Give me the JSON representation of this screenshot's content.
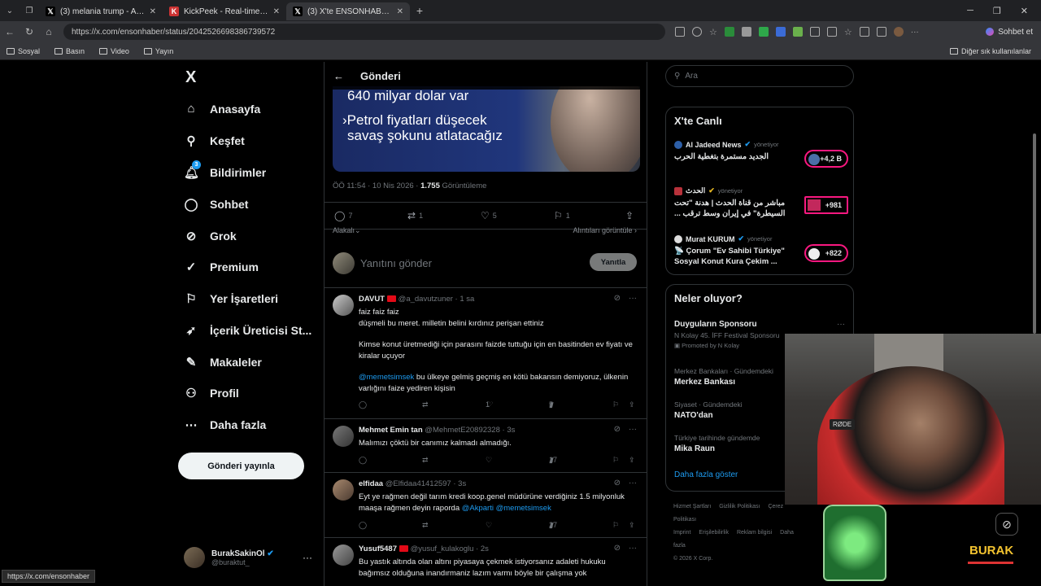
{
  "browser": {
    "tabs": [
      {
        "title": "(3) melania trump - Arama / X",
        "icon": "x-icon",
        "active": false
      },
      {
        "title": "KickPeek - Real-time URL Crawler",
        "icon": "kickpeek-icon",
        "active": false
      },
      {
        "title": "(3) X'te ENSONHABER: \"Mehmet Ş",
        "icon": "x-icon",
        "active": true
      }
    ],
    "new_tab": "+",
    "url": "https://x.com/ensonhaber/status/2042526698386739572",
    "copilot_label": "Sohbet et",
    "bookmarks": [
      "Sosyal",
      "Basın",
      "Video",
      "Yayın"
    ],
    "other_bookmarks": "Diğer sık kullanılanlar",
    "status_url": "https://x.com/ensonhaber"
  },
  "nav": {
    "logo": "X",
    "items": [
      {
        "label": "Anasayfa",
        "icon": "home-icon"
      },
      {
        "label": "Keşfet",
        "icon": "search-icon"
      },
      {
        "label": "Bildirimler",
        "icon": "bell-icon",
        "badge": "3"
      },
      {
        "label": "Sohbet",
        "icon": "chat-icon"
      },
      {
        "label": "Grok",
        "icon": "grok-icon"
      },
      {
        "label": "Premium",
        "icon": "premium-icon"
      },
      {
        "label": "Yer İşaretleri",
        "icon": "bookmark-icon"
      },
      {
        "label": "İçerik Üreticisi St...",
        "icon": "rocket-icon"
      },
      {
        "label": "Makaleler",
        "icon": "articles-icon"
      },
      {
        "label": "Profil",
        "icon": "person-icon"
      },
      {
        "label": "Daha fazla",
        "icon": "more-circle-icon"
      }
    ],
    "post_button": "Gönderi yayınla",
    "account": {
      "name": "BurakSakinOl",
      "handle": "@buraktut_",
      "more": "···"
    }
  },
  "post": {
    "header_title": "Gönderi",
    "media_line1": "640 milyar dolar var",
    "media_line2": "Petrol fiyatları düşecek",
    "media_line3": "savaş şokunu atlatacağız",
    "time": "ÖÖ 11:54 · 10 Nis 2026 · ",
    "views": "1.755",
    "views_label": " Görüntüleme",
    "stats": {
      "replies": "7",
      "reposts": "1",
      "likes": "5",
      "bookmarks": "1"
    },
    "sort_label": "Alakalı",
    "quotes_label": "Alıntıları görüntüle",
    "reply_placeholder": "Yanıtını gönder",
    "reply_button": "Yanıtla"
  },
  "replies": [
    {
      "name": "DAVUT",
      "handle": "@a_davutzuner",
      "time": "· 1 sa",
      "p1": "faiz faiz faiz",
      "p1b": "düşmeli bu meret. milletin belini kırdınız perişan ettiniz",
      "p2": "Kimse konut üretmediği için parasını faizde tuttuğu için en basitinden ev fiyatı ve kiralar uçuyor",
      "mention": "@memetsimsek",
      "p3": " bu ülkeye gelmiş geçmiş en kötü bakansın demiyoruz, ülkenin varlığını faize yediren kişisin",
      "likes": "1",
      "views": "5"
    },
    {
      "name": "Mehmet Emin tan",
      "handle": "@MehmetE20892328",
      "time": "· 3s",
      "text": "Malımızı çöktü bir canımız kalmadı almadığı.",
      "views": "17"
    },
    {
      "name": "elfidaa",
      "handle": "@Elfidaa41412597",
      "time": "· 3s",
      "text": "Eyt ye rağmen değil tarım kredi koop.genel müdürüne verdiğiniz 1.5 milyonluk maaşa rağmen deyin raporda ",
      "mention": "@Akparti @memetsimsek",
      "views": "27"
    },
    {
      "name": "Yusuf5487",
      "handle": "@yusuf_kulakoglu",
      "time": "· 2s",
      "text": "Bu yastık altında olan altını piyasaya çekmek istiyorsanız adaleti hukuku bağımsız olduğuna inandırmaniz lazım varmı böyle bir çalışma yok"
    }
  ],
  "right": {
    "search_placeholder": "Ara",
    "live_title": "X'te Canlı",
    "live": [
      {
        "host": "Al Jadeed News",
        "role": "yönetiyor",
        "title": "الجديد مستمرة بتغطية الحرب",
        "count": "+4,2 B"
      },
      {
        "host": "الحدث",
        "role": "yönetiyor",
        "title": "مباشر من قناة الحدث | هدنة \"تحت السيطرة\" في إيران وسط ترقب ...",
        "count": "+981"
      },
      {
        "host": "Murat KURUM",
        "role": "yönetiyor",
        "title": "📡 Çorum \"Ev Sahibi Türkiye\" Sosyal Konut Kura Çekim ...",
        "count": "+822"
      }
    ],
    "trends_title": "Neler oluyor?",
    "promoted": {
      "title": "Duyguların Sponsoru",
      "desc": "N Kolay 45. İFF Festival Sponsoru",
      "by": "Promoted by N Kolay"
    },
    "trends": [
      {
        "kicker": "Merkez Bankaları · Gündemdeki",
        "name": "Merkez Bankası"
      },
      {
        "kicker": "Siyaset · Gündemdeki",
        "name": "NATO'dan"
      },
      {
        "kicker": "Türkiye tarihinde gündemde",
        "name": "Mika Raun"
      }
    ],
    "show_more": "Daha fazla göster",
    "footer": [
      "Hizmet Şartları",
      "Gizlilik Politikası",
      "Çerez Politikası",
      "Imprint",
      "Erişilebilirlik",
      "Reklam bilgisi",
      "Daha fazla",
      "© 2026 X Corp."
    ]
  },
  "overlay": {
    "mic_label": "RØDE",
    "brand": "BURAK"
  }
}
